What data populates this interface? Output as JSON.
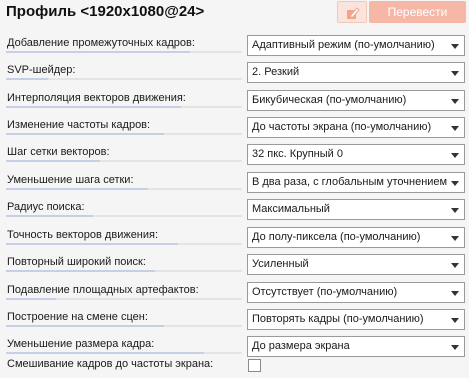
{
  "header": {
    "title": "Профиль <1920x1080@24>",
    "edit_icon": "edit-icon",
    "translate_label": "Перевести"
  },
  "rows": [
    {
      "label": "Добавление промежуточных кадров:",
      "value": "Адаптивный режим (по-умолчанию)",
      "level": 0.78
    },
    {
      "label": "SVP-шейдер:",
      "value": "2. Резкий",
      "level": 0.18
    },
    {
      "label": "Интерполяция векторов движения:",
      "value": "Бикубическая (по-умолчанию)",
      "level": 0.74
    },
    {
      "label": "Изменение частоты кадров:",
      "value": "До частоты экрана (по-умолчанию)",
      "level": 0.67
    },
    {
      "label": "Шаг сетки векторов:",
      "value": "32 пкс. Крупный 0",
      "level": 0.4
    },
    {
      "label": "Уменьшение шага сетки:",
      "value": "В два раза, с глобальным уточнением",
      "level": 0.6
    },
    {
      "label": "Радиус поиска:",
      "value": "Максимальный",
      "level": 0.37
    },
    {
      "label": "Точность векторов движения:",
      "value": "До полу-пиксела (по-умолчанию)",
      "level": 0.73
    },
    {
      "label": "Повторный широкий поиск:",
      "value": "Усиленный",
      "level": 0.63
    },
    {
      "label": "Подавление площадных артефактов:",
      "value": "Отсутствует (по-умолчанию)",
      "level": 0.21
    },
    {
      "label": "Построение на смене сцен:",
      "value": "Повторять кадры (по-умолчанию)",
      "level": 0.67
    },
    {
      "label": "Уменьшение размера кадра:",
      "value": "До размера экрана",
      "level": 0.84
    }
  ],
  "checkbox_row": {
    "label": "Смешивание кадров до частоты экрана:",
    "checked": false
  },
  "colors": {
    "translate_button": "#f7b7a6",
    "edit_button": "#fbe4dc",
    "track_fill": "#c6cfe6"
  }
}
